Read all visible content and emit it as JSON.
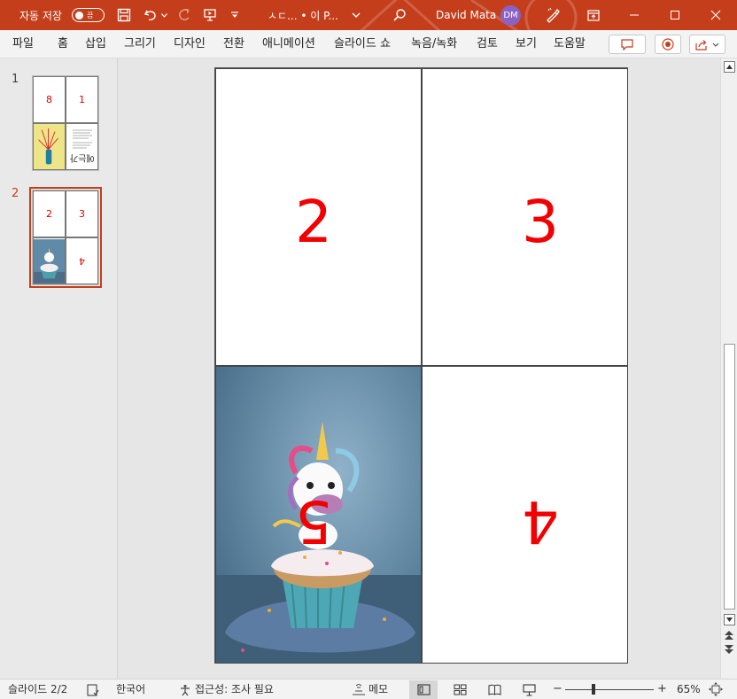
{
  "titlebar": {
    "autosave_label": "자동 저장",
    "autosave_state": "끔",
    "file_title": "ㅅㄷ... • 이 P...",
    "user_name": "David Mata",
    "user_initials": "DM",
    "accent": "#c43e1c"
  },
  "menu": {
    "items": [
      "파일",
      "홈",
      "삽입",
      "그리기",
      "디자인",
      "전환",
      "애니메이션",
      "슬라이드 쇼",
      "녹음/녹화",
      "검토",
      "보기",
      "도움말"
    ]
  },
  "thumbnails": [
    {
      "number": "1",
      "cells": [
        "8",
        "1",
        "",
        "에는가"
      ]
    },
    {
      "number": "2",
      "cells": [
        "2",
        "3",
        "",
        "4"
      ],
      "selected": true
    }
  ],
  "slide": {
    "cells": [
      {
        "label": "2"
      },
      {
        "label": "3"
      },
      {
        "label": "5"
      },
      {
        "label": "4"
      }
    ],
    "number_color": "#f20000"
  },
  "status": {
    "slide_info": "슬라이드 2/2",
    "language": "한국어",
    "accessibility": "접근성: 조사 필요",
    "notes": "메모",
    "zoom_minus": "−",
    "zoom_plus": "+",
    "zoom": "65%",
    "zoom_level_percent": 65
  }
}
